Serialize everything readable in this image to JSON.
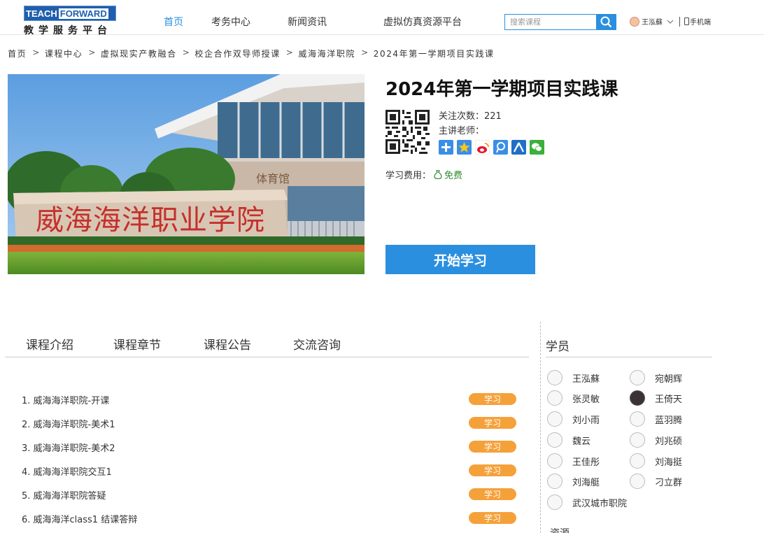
{
  "header": {
    "logo_teach": "TEACH",
    "logo_forward": "FORWARD",
    "logo_subtitle": "教学服务平台",
    "nav": [
      {
        "label": "首页",
        "active": true
      },
      {
        "label": "考务中心",
        "active": false
      },
      {
        "label": "新闻资讯",
        "active": false
      },
      {
        "label": "虚拟仿真资源平台",
        "active": false
      }
    ],
    "search_placeholder": "搜索课程",
    "user_name": "王泓蘇",
    "mobile_label": "手机端",
    "accent_color": "#2b8fe0"
  },
  "breadcrumb": [
    "首页",
    "课程中心",
    "虚拟现实产教融合",
    "校企合作双导师授课",
    "威海海洋职院",
    "2024年第一学期项目实践课"
  ],
  "course": {
    "title": "2024年第一学期项目实践课",
    "follow_label": "关注次数：221",
    "teacher_label": "主讲老师：",
    "fee_label": "学习费用：",
    "fee_value": "免费",
    "start_button": "开始学习",
    "hero_sign_text": "威海海洋职业学院",
    "hero_building_text": "体育馆"
  },
  "tabs": [
    "课程介绍",
    "课程章节",
    "课程公告",
    "交流咨询"
  ],
  "lessons": [
    {
      "title": "1. 威海海洋职院-开课",
      "action": "学习"
    },
    {
      "title": "2. 威海海洋职院-美术1",
      "action": "学习"
    },
    {
      "title": "3. 威海海洋职院-美术2",
      "action": "学习"
    },
    {
      "title": "4. 威海海洋职院交互1",
      "action": "学习"
    },
    {
      "title": "5. 威海海洋职院答疑",
      "action": "学习"
    },
    {
      "title": "6. 威海海洋class1 结课答辩",
      "action": "学习"
    }
  ],
  "students_title": "学员",
  "students": [
    "王泓蘇",
    "宛朝辉",
    "张灵敏",
    "王倚天",
    "刘小雨",
    "蓝羽腾",
    "魏云",
    "刘兆硕",
    "王佳彤",
    "刘海挺",
    "刘海艇",
    "刁立群",
    "武汉城市职院"
  ],
  "next_section_partial": "资源"
}
